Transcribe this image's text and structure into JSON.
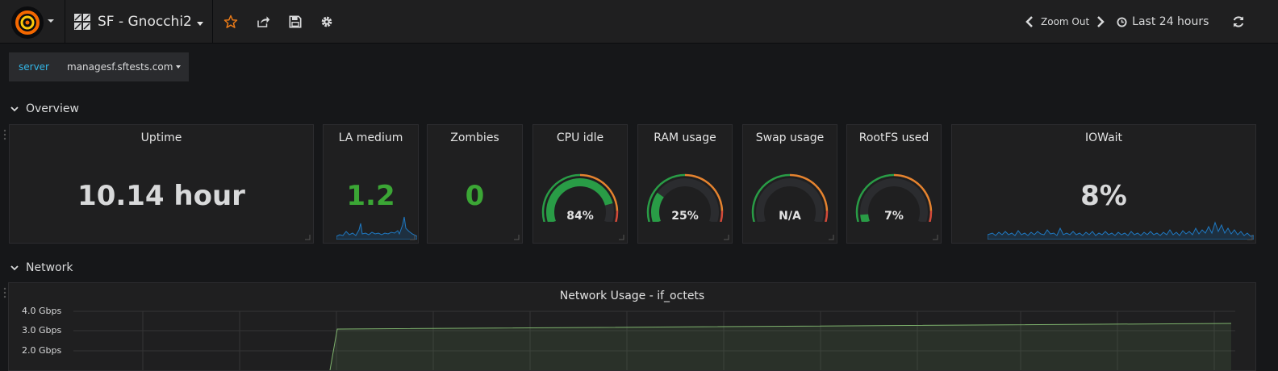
{
  "navbar": {
    "dashboard_title": "SF - Gnocchi2",
    "zoom_out_label": "Zoom Out",
    "time_range_label": "Last 24 hours",
    "icons": [
      "grafana-logo-icon",
      "dashboard-grid-icon",
      "star-icon",
      "share-icon",
      "save-icon",
      "gear-icon",
      "chevron-left-icon",
      "chevron-right-icon",
      "clock-icon",
      "refresh-icon"
    ]
  },
  "template_vars": {
    "server_label": "server",
    "server_value": "managesf.sftests.com"
  },
  "rows": {
    "overview": "Overview",
    "network": "Network"
  },
  "panels": {
    "uptime": {
      "title": "Uptime",
      "value": "10.14 hour"
    },
    "la_medium": {
      "title": "LA medium",
      "value": "1.2"
    },
    "zombies": {
      "title": "Zombies",
      "value": "0"
    },
    "cpu_idle": {
      "title": "CPU idle",
      "value": "84%",
      "gauge_fraction": 0.84
    },
    "ram_usage": {
      "title": "RAM usage",
      "value": "25%",
      "gauge_fraction": 0.25
    },
    "swap_usage": {
      "title": "Swap usage",
      "value": "N/A",
      "gauge_fraction": 0
    },
    "rootfs_used": {
      "title": "RootFS used",
      "value": "7%",
      "gauge_fraction": 0.07
    },
    "iowait": {
      "title": "IOWait",
      "value": "8%"
    }
  },
  "network_graph": {
    "title": "Network Usage - if_octets",
    "y_ticks": [
      "4.0 Gbps",
      "3.0 Gbps",
      "2.0 Gbps"
    ]
  },
  "colors": {
    "green": "#299c46",
    "value_green": "#3ba635",
    "orange": "#e5832f",
    "red": "#d44a3a",
    "accent_blue": "#33b5e5",
    "star": "#eb7b18",
    "spark_blue": "#1f78c1"
  }
}
